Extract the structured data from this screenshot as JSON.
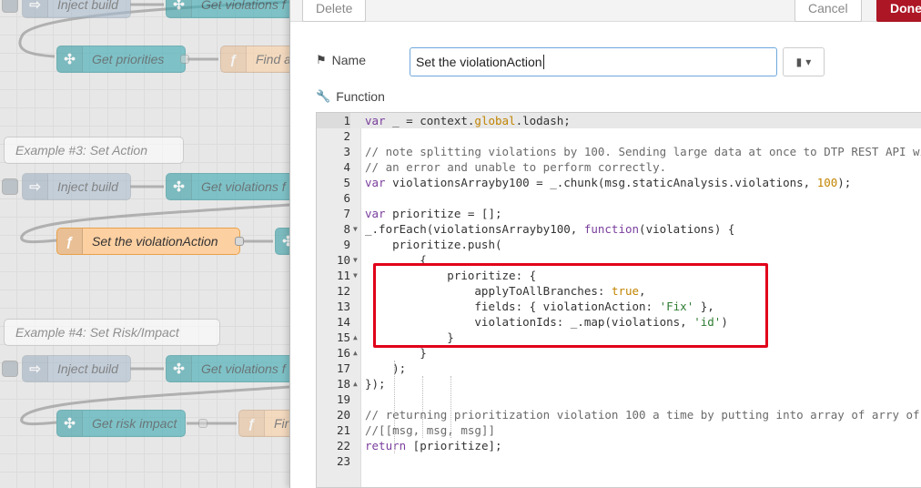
{
  "flow": {
    "nodes": {
      "inject_build_1": "Inject build",
      "get_violations_1": "Get violations f",
      "get_priorities": "Get priorities",
      "find_partial": "Find a",
      "example3_comment": "Example #3: Set Action",
      "inject_build_2": "Inject build",
      "get_violations_2": "Get violations f",
      "set_violation_action": "Set the violationAction",
      "example4_comment": "Example #4: Set Risk/Impact",
      "inject_build_3": "Inject build",
      "get_violations_3": "Get violations f",
      "get_risk_impact": "Get risk impact",
      "fir_partial": "Fir"
    }
  },
  "tray": {
    "delete_label": "Delete",
    "cancel_label": "Cancel",
    "done_label": "Done",
    "name_label": "Name",
    "name_value": "Set the violationAction",
    "function_label": "Function"
  },
  "editor": {
    "line_numbers": [
      "1",
      "2",
      "3",
      "4",
      "5",
      "6",
      "7",
      "8",
      "9",
      "10",
      "11",
      "12",
      "13",
      "14",
      "15",
      "16",
      "17",
      "18",
      "19",
      "20",
      "21",
      "22",
      "23"
    ],
    "highlight_color": "#e1001a"
  },
  "colors": {
    "done_button": "#ad1625",
    "inject_node": "#a6bbcf",
    "link_node": "#3fadb5",
    "function_node": "#fdd0a2"
  }
}
